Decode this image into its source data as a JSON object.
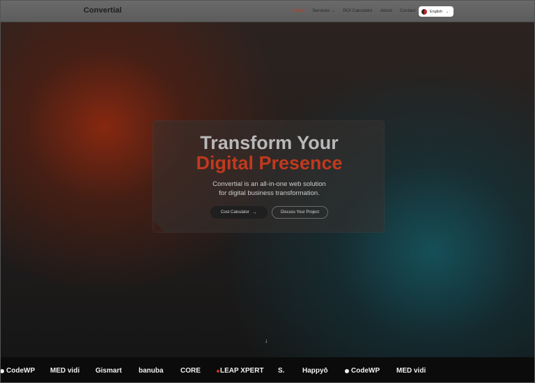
{
  "nav": {
    "brand": "Convertial",
    "links": [
      {
        "label": "Home",
        "active": true
      },
      {
        "label": "Services",
        "dropdown": true
      },
      {
        "label": "ROI Calculator"
      },
      {
        "label": "About"
      },
      {
        "label": "Contact"
      }
    ],
    "language": {
      "label": "English",
      "icon": "flag-icon"
    }
  },
  "hero": {
    "headline_line1": "Transform Your",
    "headline_line2": "Digital Presence",
    "subtitle_line1": "Convertial is an all-in-one web solution",
    "subtitle_line2": "for digital business transformation.",
    "primary_button": "Cost Calculator",
    "secondary_button": "Discuss Your Project",
    "scroll_icon": "↓"
  },
  "logos": [
    "CodeWP",
    "MED vidi",
    "Gismart",
    "banuba",
    "CORE",
    "LEAP XPERT",
    "S.",
    "Happyō",
    "CodeWP",
    "MED vidi"
  ],
  "colors": {
    "accent": "#c2391d",
    "headline_grey": "#b9b9b9",
    "strip_bg": "#0b0b0b"
  }
}
